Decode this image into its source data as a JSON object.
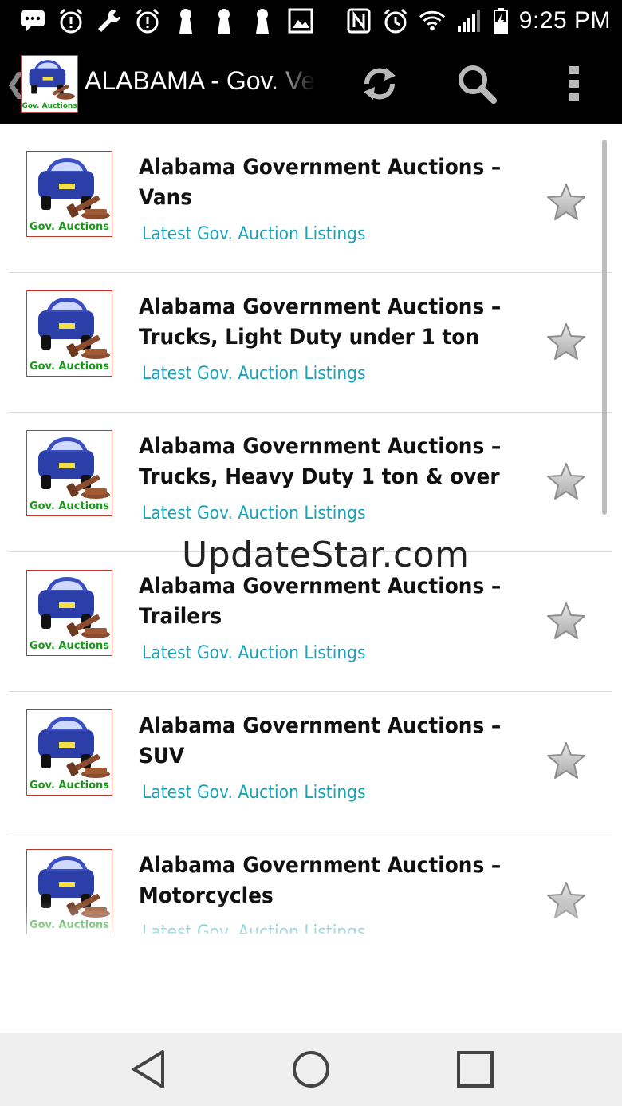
{
  "status_bar": {
    "time": "9:25 PM",
    "icons": [
      "message-icon",
      "alarm-alert-icon",
      "wrench-icon",
      "alarm-alert-icon",
      "keyhole-icon",
      "keyhole-icon",
      "keyhole-icon",
      "image-icon",
      "nfc-icon",
      "alarm-icon",
      "wifi-icon",
      "signal-icon",
      "battery-charging-icon"
    ]
  },
  "action_bar": {
    "title": "ALABAMA - Gov.  Vehicle",
    "logo_label": "Gov. Auctions",
    "actions": [
      "refresh-icon",
      "search-icon",
      "overflow-menu-icon"
    ]
  },
  "list": {
    "items": [
      {
        "title": "Alabama Government Auctions – Vans",
        "subtitle": "Latest Gov. Auction Listings",
        "thumb_label": "Gov. Auctions"
      },
      {
        "title": "Alabama Government Auctions – Trucks, Light Duty under 1 ton",
        "subtitle": "Latest Gov. Auction Listings",
        "thumb_label": "Gov. Auctions"
      },
      {
        "title": "Alabama Government Auctions – Trucks, Heavy Duty 1 ton & over",
        "subtitle": "Latest Gov. Auction Listings",
        "thumb_label": "Gov. Auctions"
      },
      {
        "title": "Alabama Government Auctions – Trailers",
        "subtitle": "Latest Gov. Auction Listings",
        "thumb_label": "Gov. Auctions"
      },
      {
        "title": "Alabama Government Auctions – SUV",
        "subtitle": "Latest Gov. Auction Listings",
        "thumb_label": "Gov. Auctions"
      },
      {
        "title": "Alabama Government Auctions – Motorcycles",
        "subtitle": "Latest Gov. Auction Listings",
        "thumb_label": "Gov. Auctions"
      }
    ]
  },
  "watermark": "UpdateStar.com",
  "colors": {
    "bar_bg": "#000000",
    "subtitle": "#1aa3b8",
    "thumb_label": "#1a9a1a",
    "car": "#2c3ea8"
  }
}
